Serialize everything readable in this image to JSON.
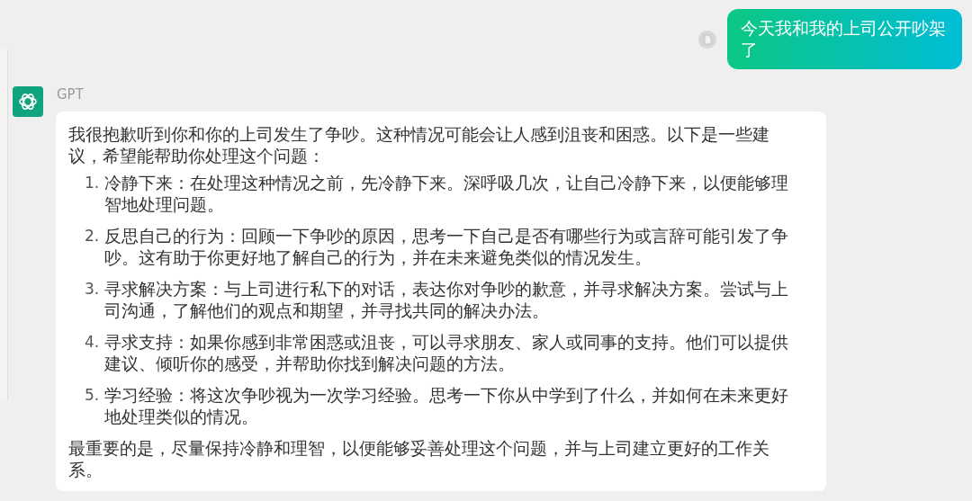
{
  "user_message": {
    "text": "今天我和我的上司公开吵架了"
  },
  "assistant": {
    "name": "GPT",
    "intro": "我很抱歉听到你和你的上司发生了争吵。这种情况可能会让人感到沮丧和困惑。以下是一些建议，希望能帮助你处理这个问题：",
    "items": [
      {
        "number": "1.",
        "text": "冷静下来：在处理这种情况之前，先冷静下来。深呼吸几次，让自己冷静下来，以便能够理智地处理问题。"
      },
      {
        "number": "2.",
        "text": "反思自己的行为：回顾一下争吵的原因，思考一下自己是否有哪些行为或言辞可能引发了争吵。这有助于你更好地了解自己的行为，并在未来避免类似的情况发生。"
      },
      {
        "number": "3.",
        "text": "寻求解决方案：与上司进行私下的对话，表达你对争吵的歉意，并寻求解决方案。尝试与上司沟通，了解他们的观点和期望，并寻找共同的解决办法。"
      },
      {
        "number": "4.",
        "text": "寻求支持：如果你感到非常困惑或沮丧，可以寻求朋友、家人或同事的支持。他们可以提供建议、倾听你的感受，并帮助你找到解决问题的方法。"
      },
      {
        "number": "5.",
        "text": "学习经验：将这次争吵视为一次学习经验。思考一下你从中学到了什么，并如何在未来更好地处理类似的情况。"
      }
    ],
    "closing": "最重要的是，尽量保持冷静和理智，以便能够妥善处理这个问题，并与上司建立更好的工作关系。"
  }
}
